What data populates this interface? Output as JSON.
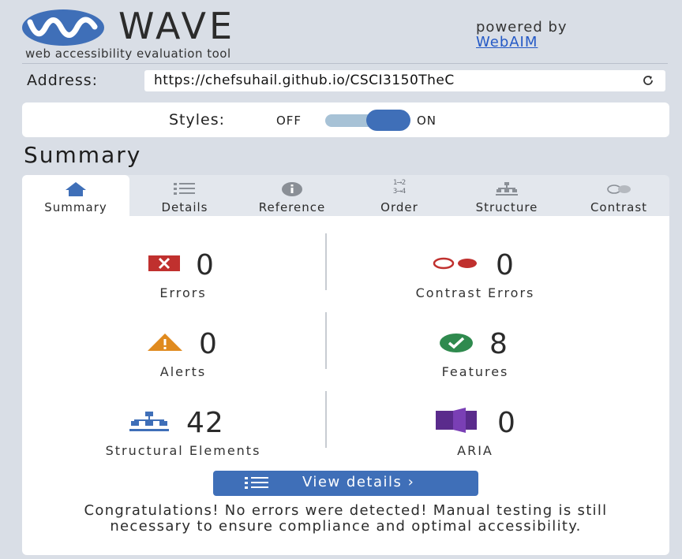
{
  "header": {
    "logo_text": "WAVE",
    "tagline": "web accessibility evaluation tool",
    "powered_by": "powered by",
    "webaim_link": "WebAIM"
  },
  "address": {
    "label": "Address:",
    "value": "https://chefsuhail.github.io/CSCI3150TheC"
  },
  "styles": {
    "label": "Styles:",
    "off": "OFF",
    "on": "ON",
    "state": "on"
  },
  "summary_heading": "Summary",
  "tabs": [
    {
      "label": "Summary",
      "icon": "home-icon",
      "active": true
    },
    {
      "label": "Details",
      "icon": "list-icon"
    },
    {
      "label": "Reference",
      "icon": "info-icon"
    },
    {
      "label": "Order",
      "icon": "order-icon",
      "icon_text": [
        "1⟶2",
        "3⟶4"
      ]
    },
    {
      "label": "Structure",
      "icon": "structure-icon"
    },
    {
      "label": "Contrast",
      "icon": "contrast-icon"
    }
  ],
  "stats": {
    "errors": {
      "count": "0",
      "label": "Errors",
      "icon": "error-icon"
    },
    "contrast_errors": {
      "count": "0",
      "label": "Contrast Errors",
      "icon": "contrast-error-icon"
    },
    "alerts": {
      "count": "0",
      "label": "Alerts",
      "icon": "alert-icon"
    },
    "features": {
      "count": "8",
      "label": "Features",
      "icon": "feature-check-icon"
    },
    "structural": {
      "count": "42",
      "label": "Structural Elements",
      "icon": "structure-icon"
    },
    "aria": {
      "count": "0",
      "label": "ARIA",
      "icon": "aria-icon"
    }
  },
  "view_details": {
    "label": "View details ›"
  },
  "congrats": "Congratulations! No errors were detected! Manual testing is still necessary to ensure compliance and optimal accessibility.",
  "colors": {
    "accent": "#3f6fb8",
    "error": "#c0302e",
    "alert": "#e08a1e",
    "feature": "#2f8a4e",
    "aria": "#5a2b8c",
    "background": "#d9dee6"
  }
}
